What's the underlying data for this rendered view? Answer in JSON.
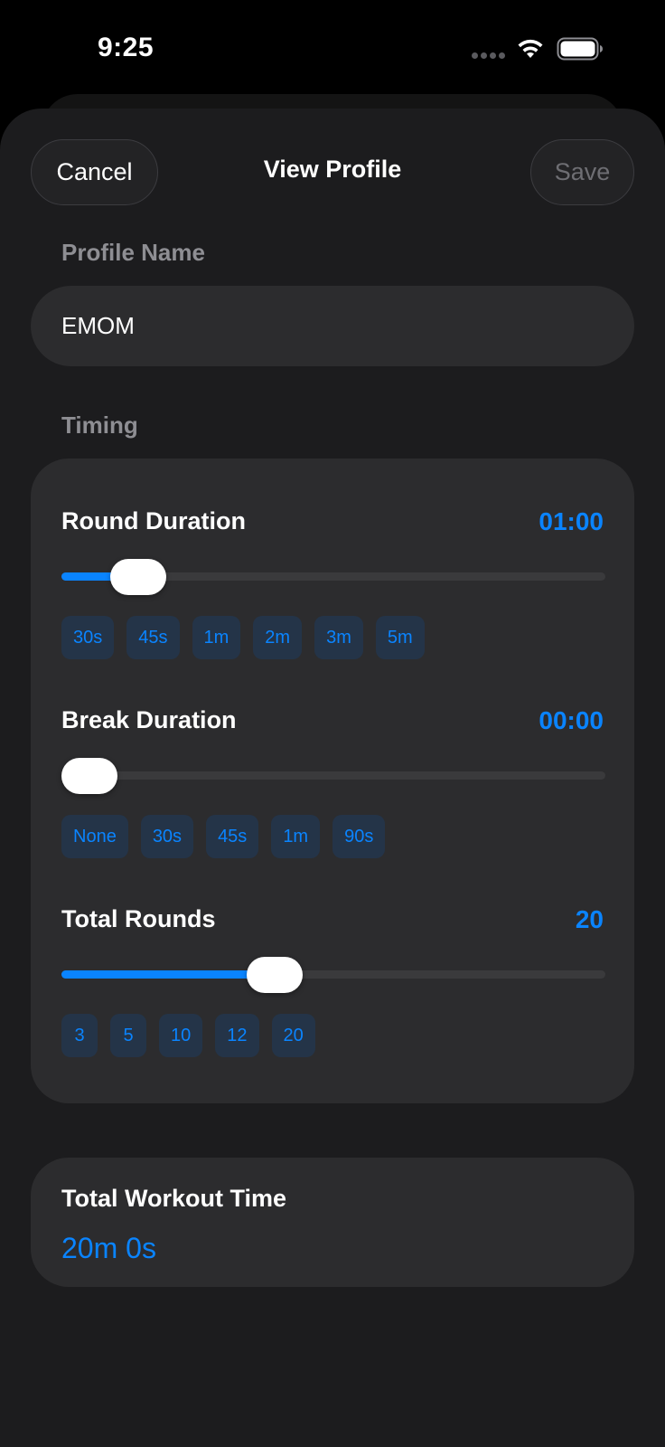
{
  "status_bar": {
    "time": "9:25",
    "icons": [
      "signal-dots-icon",
      "wifi-icon",
      "battery-icon"
    ]
  },
  "nav": {
    "cancel_label": "Cancel",
    "title": "View Profile",
    "save_label": "Save"
  },
  "profile": {
    "section_label": "Profile Name",
    "name_value": "EMOM"
  },
  "timing": {
    "section_label": "Timing",
    "round_duration": {
      "label": "Round Duration",
      "value": "01:00",
      "slider_fraction": 0.1,
      "chips": [
        "30s",
        "45s",
        "1m",
        "2m",
        "3m",
        "5m"
      ]
    },
    "break_duration": {
      "label": "Break Duration",
      "value": "00:00",
      "slider_fraction": 0,
      "chips": [
        "None",
        "30s",
        "45s",
        "1m",
        "90s"
      ]
    },
    "total_rounds": {
      "label": "Total Rounds",
      "value": "20",
      "slider_fraction": 0.38,
      "chips": [
        "3",
        "5",
        "10",
        "12",
        "20"
      ]
    }
  },
  "summary": {
    "title": "Total Workout Time",
    "value": "20m 0s"
  },
  "colors": {
    "accent": "#0a84ff",
    "background": "#1c1c1e",
    "card": "#2c2c2e",
    "secondary_text": "#8e8e93"
  }
}
